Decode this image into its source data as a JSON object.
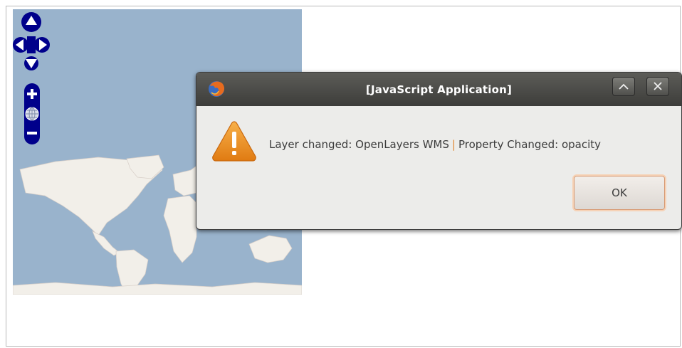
{
  "dialog": {
    "title": "[JavaScript Application]",
    "message_part1": "Layer changed: OpenLayers WMS",
    "separator": "|",
    "message_part2": "Property Changed: opacity",
    "ok_label": "OK",
    "app_icon": "firefox-icon",
    "alert_icon": "warning-triangle-icon"
  },
  "map": {
    "pan_icons": [
      "pan-up-icon",
      "pan-left-icon",
      "pan-right-icon",
      "pan-down-icon"
    ],
    "zoom_icons": [
      "zoom-in-icon",
      "zoom-world-icon",
      "zoom-out-icon"
    ]
  },
  "colors": {
    "ocean": "#99b3cc",
    "land": "#f2efe9",
    "controls": "#00008b",
    "accent": "#e08b3a"
  }
}
